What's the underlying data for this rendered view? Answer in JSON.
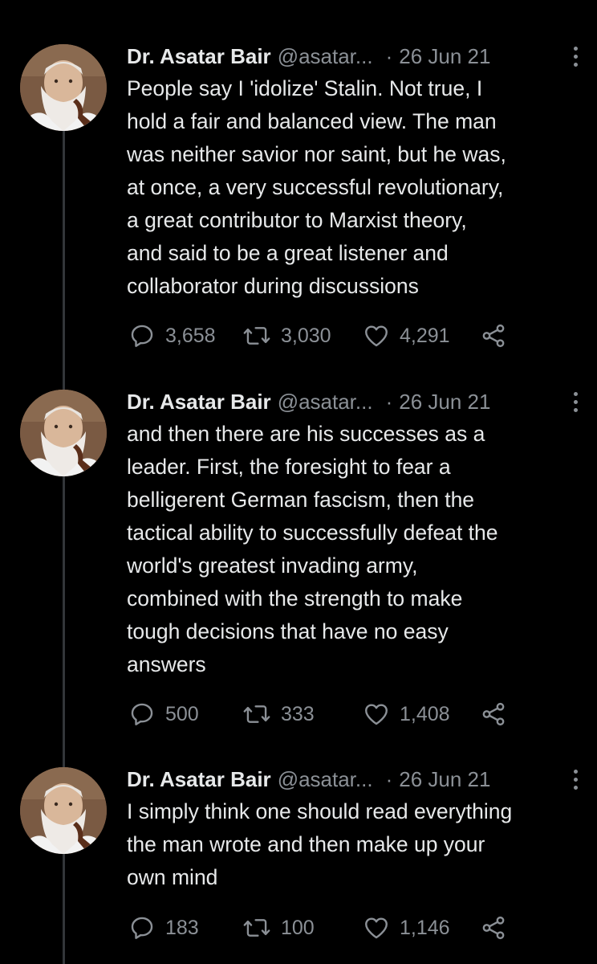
{
  "tweets": [
    {
      "name": "Dr. Asatar Bair",
      "handle": "@asatar...",
      "separator": "·",
      "date": "26 Jun 21",
      "text": "People say I 'idolize' Stalin. Not true, I\nhold a fair and balanced view. The man\nwas neither savior nor saint, but he was,\nat once, a very successful revolutionary,\na great contributor to Marxist theory,\nand said to be a great listener and\ncollaborator during discussions",
      "replies": "3,658",
      "retweets": "3,030",
      "likes": "4,291"
    },
    {
      "name": "Dr. Asatar Bair",
      "handle": "@asatar...",
      "separator": "·",
      "date": "26 Jun 21",
      "text": "and then there are his successes as a\nleader. First, the foresight to fear a\nbelligerent German fascism, then the\ntactical ability to successfully defeat the\nworld's greatest invading army,\ncombined with the strength to make\ntough decisions that have no easy\nanswers",
      "replies": "500",
      "retweets": "333",
      "likes": "1,408"
    },
    {
      "name": "Dr. Asatar Bair",
      "handle": "@asatar...",
      "separator": "·",
      "date": "26 Jun 21",
      "text": "I simply think one should read everything\nthe man wrote and then make up your\nown mind",
      "replies": "183",
      "retweets": "100",
      "likes": "1,146"
    }
  ],
  "icons": {
    "reply": "reply-icon",
    "retweet": "retweet-icon",
    "like": "like-icon",
    "share": "share-icon",
    "more": "more-options-icon"
  },
  "colors": {
    "background": "#000000",
    "text": "#e7e9ea",
    "secondary": "#8b9096",
    "thread_line": "#333639"
  }
}
